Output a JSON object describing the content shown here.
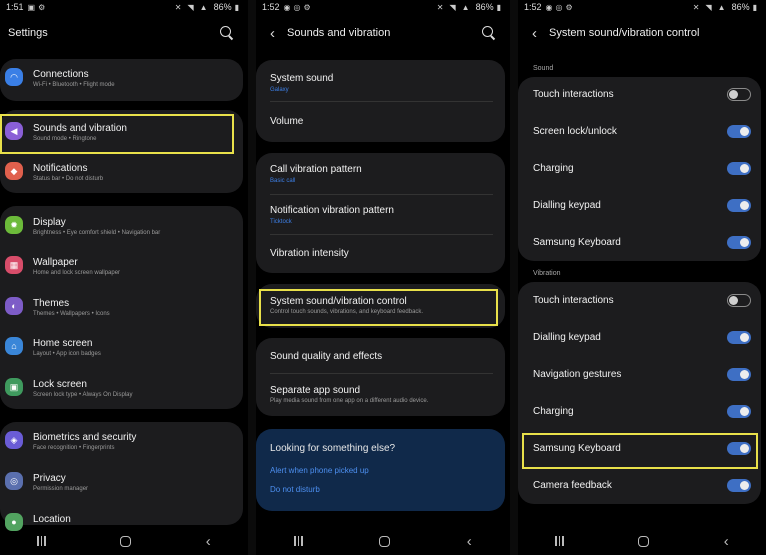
{
  "screen1": {
    "time": "1:51",
    "battery": "86%",
    "title": "Settings",
    "items": [
      {
        "title": "Connections",
        "subtitle": "Wi-Fi  •  Bluetooth  •  Flight mode",
        "icon": "wifi-icon",
        "color": "#3a7fe6"
      },
      {
        "title": "Sounds and vibration",
        "subtitle": "Sound mode  •  Ringtone",
        "icon": "speaker-icon",
        "color": "#8a5fd6"
      },
      {
        "title": "Notifications",
        "subtitle": "Status bar  •  Do not disturb",
        "icon": "bell-icon",
        "color": "#e0604d"
      },
      {
        "title": "Display",
        "subtitle": "Brightness  •  Eye comfort shield  •  Navigation bar",
        "icon": "sun-icon",
        "color": "#6cba3a"
      },
      {
        "title": "Wallpaper",
        "subtitle": "Home and lock screen wallpaper",
        "icon": "image-icon",
        "color": "#d84d6a"
      },
      {
        "title": "Themes",
        "subtitle": "Themes  •  Wallpapers  •  Icons",
        "icon": "palette-icon",
        "color": "#7d5cc7"
      },
      {
        "title": "Home screen",
        "subtitle": "Layout  •  App icon badges",
        "icon": "home-icon",
        "color": "#3a86d8"
      },
      {
        "title": "Lock screen",
        "subtitle": "Screen lock type  •  Always On Display",
        "icon": "lock-icon",
        "color": "#3f9a5e"
      },
      {
        "title": "Biometrics and security",
        "subtitle": "Face recognition  •  Fingerprints",
        "icon": "shield-icon",
        "color": "#6a5cd6"
      },
      {
        "title": "Privacy",
        "subtitle": "Permission manager",
        "icon": "privacy-icon",
        "color": "#5a6fae"
      },
      {
        "title": "Location",
        "subtitle": "",
        "icon": "location-icon",
        "color": "#52a360"
      }
    ]
  },
  "screen2": {
    "time": "1:52",
    "battery": "86%",
    "title": "Sounds and vibration",
    "system_sound": {
      "title": "System sound",
      "subtitle": "Galaxy"
    },
    "volume": {
      "title": "Volume"
    },
    "call_vibration": {
      "title": "Call vibration pattern",
      "subtitle": "Basic call"
    },
    "notification_vibration": {
      "title": "Notification vibration pattern",
      "subtitle": "Ticktock"
    },
    "vibration_intensity": {
      "title": "Vibration intensity"
    },
    "system_control": {
      "title": "System sound/vibration control",
      "subtitle": "Control touch sounds, vibrations, and keyboard feedback."
    },
    "sound_quality": {
      "title": "Sound quality and effects"
    },
    "separate_app": {
      "title": "Separate app sound",
      "subtitle": "Play media sound from one app on a different audio device."
    },
    "looking": {
      "title": "Looking for something else?",
      "link1": "Alert when phone picked up",
      "link2": "Do not disturb"
    }
  },
  "screen3": {
    "time": "1:52",
    "battery": "86%",
    "title": "System sound/vibration control",
    "sound_label": "Sound",
    "sound_items": [
      {
        "title": "Touch interactions",
        "on": false
      },
      {
        "title": "Screen lock/unlock",
        "on": true
      },
      {
        "title": "Charging",
        "on": true
      },
      {
        "title": "Dialling keypad",
        "on": true
      },
      {
        "title": "Samsung Keyboard",
        "on": true
      }
    ],
    "vibration_label": "Vibration",
    "vibration_items": [
      {
        "title": "Touch interactions",
        "on": false
      },
      {
        "title": "Dialling keypad",
        "on": true
      },
      {
        "title": "Navigation gestures",
        "on": true
      },
      {
        "title": "Charging",
        "on": true
      },
      {
        "title": "Samsung Keyboard",
        "on": true
      },
      {
        "title": "Camera feedback",
        "on": true
      }
    ]
  },
  "colors": {
    "highlight": "#e8e04a",
    "toggle_on": "#3e6fc4",
    "link": "#4d8ff0"
  }
}
